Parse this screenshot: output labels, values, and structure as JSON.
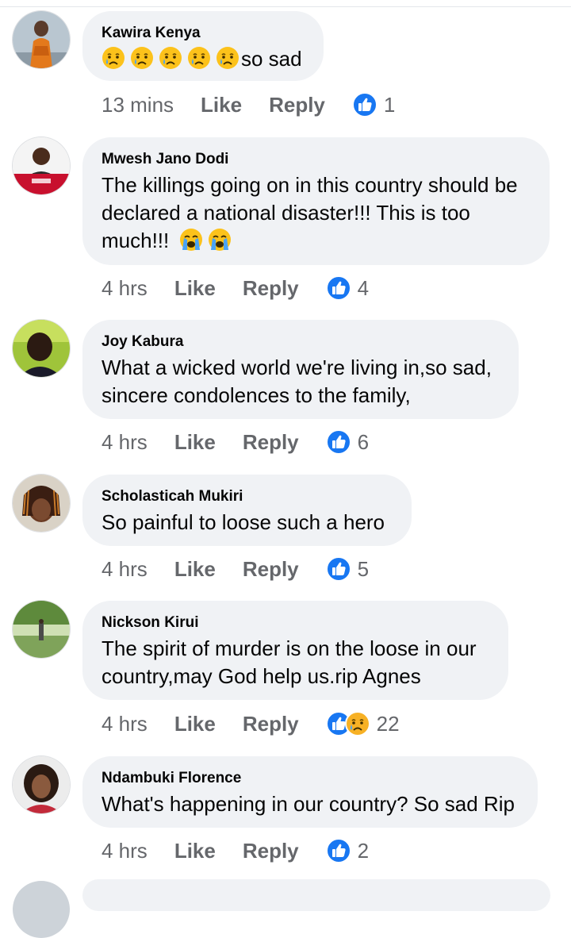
{
  "comments": [
    {
      "author": "Kawira Kenya",
      "text": "so sad",
      "emoji_prefix": [
        "sad-tear-emoji",
        "sad-tear-emoji",
        "sad-tear-emoji",
        "sad-tear-emoji",
        "sad-tear-emoji"
      ],
      "time": "13 mins",
      "like": "Like",
      "reply": "Reply",
      "reactions": [
        "like"
      ],
      "count": "1"
    },
    {
      "author": "Mwesh Jano Dodi",
      "text_lines": [
        "The killings going on in this country should be",
        "declared a national disaster!!! This is too",
        "much!!!"
      ],
      "emoji_suffix": [
        "loudly-crying-emoji",
        "loudly-crying-emoji"
      ],
      "time": "4 hrs",
      "like": "Like",
      "reply": "Reply",
      "reactions": [
        "like"
      ],
      "count": "4"
    },
    {
      "author": "Joy Kabura",
      "text_lines": [
        "What a wicked world we're living in,so sad,",
        "sincere condolences to the family,"
      ],
      "time": "4 hrs",
      "like": "Like",
      "reply": "Reply",
      "reactions": [
        "like"
      ],
      "count": "6"
    },
    {
      "author": "Scholasticah Mukiri",
      "text_lines": [
        "So painful to loose such a hero"
      ],
      "time": "4 hrs",
      "like": "Like",
      "reply": "Reply",
      "reactions": [
        "like"
      ],
      "count": "5"
    },
    {
      "author": "Nickson Kirui",
      "text_lines": [
        "The spirit of murder is on the loose in our",
        "country,may God help us.rip Agnes"
      ],
      "time": "4 hrs",
      "like": "Like",
      "reply": "Reply",
      "reactions": [
        "like",
        "sad"
      ],
      "count": "22"
    },
    {
      "author": "Ndambuki Florence",
      "text_lines": [
        "What's happening in our country? So sad Rip"
      ],
      "time": "4 hrs",
      "like": "Like",
      "reply": "Reply",
      "reactions": [
        "like"
      ],
      "count": "2"
    }
  ],
  "colors": {
    "like_blue": "#1877f2",
    "bubble": "#f0f2f5",
    "meta_gray": "#65676b",
    "sad_yellow": "#f7b125"
  }
}
